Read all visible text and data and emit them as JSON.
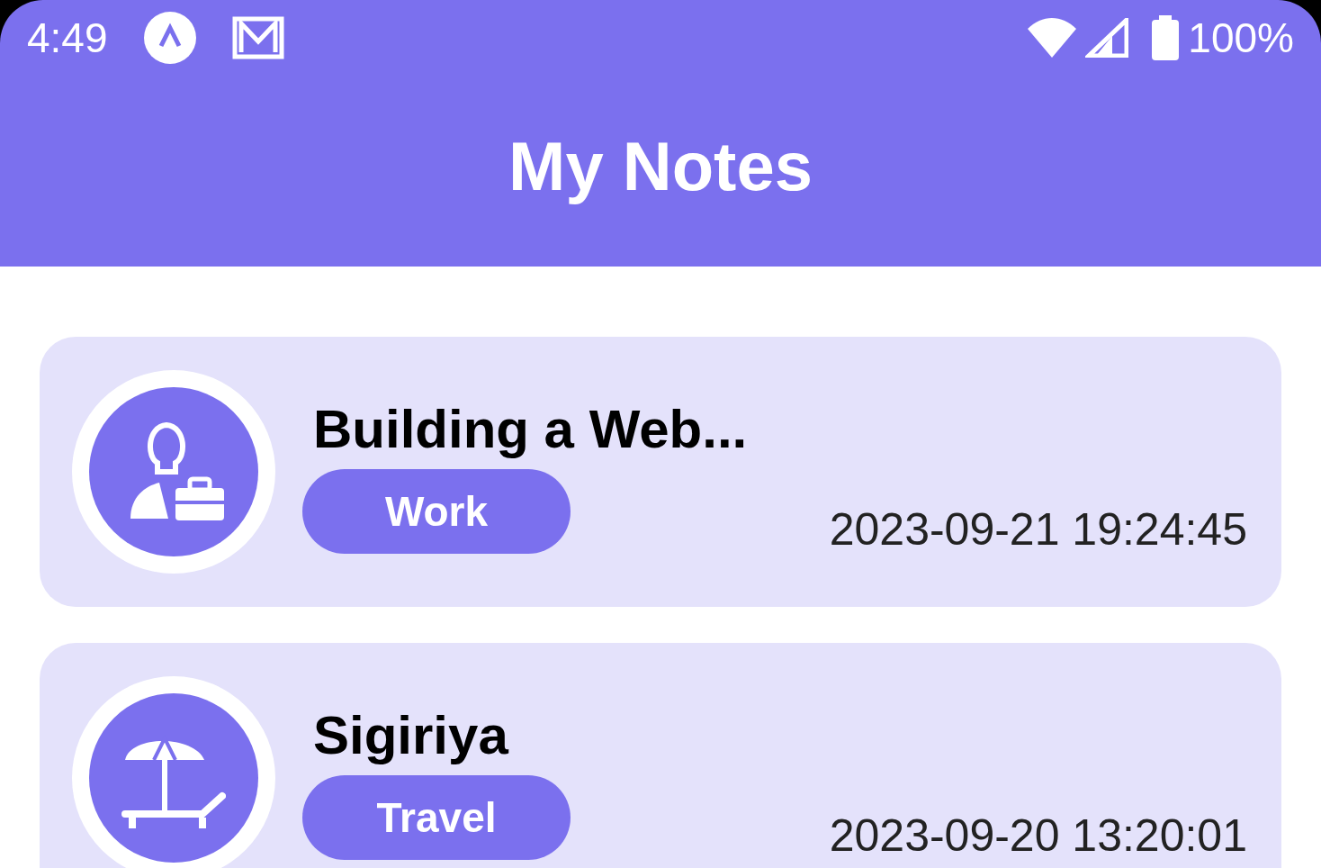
{
  "status_bar": {
    "time": "4:49",
    "battery": "100%"
  },
  "header": {
    "title": "My Notes"
  },
  "notes": [
    {
      "kind": "work",
      "title": "Building a Web...",
      "tag": "Work",
      "timestamp": "2023-09-21 19:24:45"
    },
    {
      "kind": "travel",
      "title": "Sigiriya",
      "tag": "Travel",
      "timestamp": "2023-09-20 13:20:01"
    }
  ]
}
